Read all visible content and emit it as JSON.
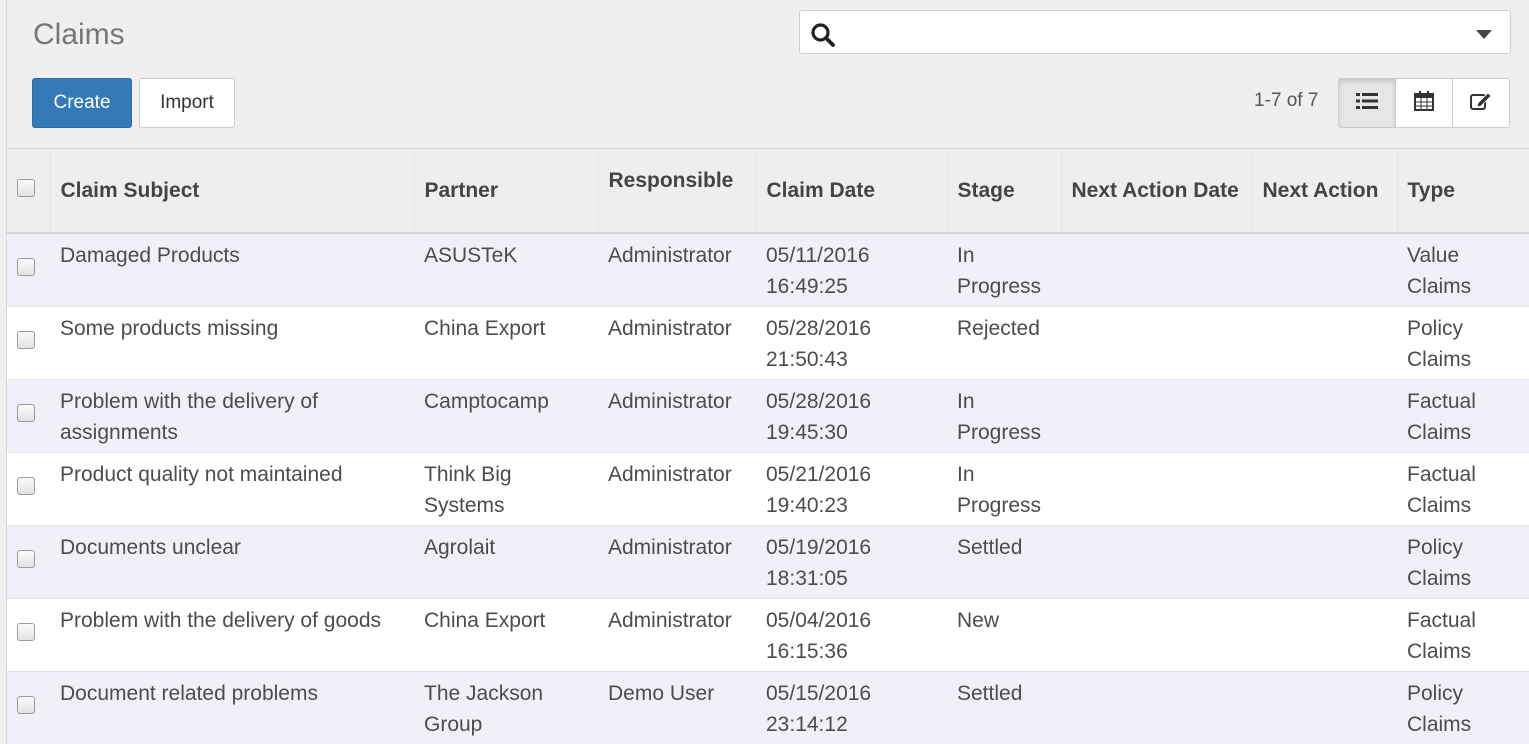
{
  "header": {
    "title": "Claims"
  },
  "search": {
    "value": "",
    "placeholder": ""
  },
  "buttons": {
    "create": "Create",
    "import": "Import"
  },
  "pager": {
    "text": "1-7 of 7"
  },
  "views": [
    {
      "name": "list-view",
      "icon": "list-icon",
      "active": true
    },
    {
      "name": "calendar-view",
      "icon": "calendar-icon",
      "active": false
    },
    {
      "name": "form-view",
      "icon": "edit-icon",
      "active": false
    }
  ],
  "table": {
    "columns": [
      "Claim Subject",
      "Partner",
      "Responsible",
      "Claim Date",
      "Stage",
      "Next Action Date",
      "Next Action",
      "Type"
    ],
    "rows": [
      [
        "Damaged Products",
        "ASUSTeK",
        "Administrator",
        "05/11/2016 16:49:25",
        "In Progress",
        "",
        "",
        "Value Claims"
      ],
      [
        "Some products missing",
        "China Export",
        "Administrator",
        "05/28/2016 21:50:43",
        "Rejected",
        "",
        "",
        "Policy Claims"
      ],
      [
        "Problem with the delivery of assignments",
        "Camptocamp",
        "Administrator",
        "05/28/2016 19:45:30",
        "In Progress",
        "",
        "",
        "Factual Claims"
      ],
      [
        "Product quality not maintained",
        "Think Big Systems",
        "Administrator",
        "05/21/2016 19:40:23",
        "In Progress",
        "",
        "",
        "Factual Claims"
      ],
      [
        "Documents unclear",
        "Agrolait",
        "Administrator",
        "05/19/2016 18:31:05",
        "Settled",
        "",
        "",
        "Policy Claims"
      ],
      [
        "Problem with the delivery of goods",
        "China Export",
        "Administrator",
        "05/04/2016 16:15:36",
        "New",
        "",
        "",
        "Factual Claims"
      ],
      [
        "Document related problems",
        "The Jackson Group",
        "Demo User",
        "05/15/2016 23:14:12",
        "Settled",
        "",
        "",
        "Policy Claims"
      ]
    ]
  },
  "colors": {
    "primary": "#337ab7",
    "control_panel_bg": "#f0eeee",
    "row_stripe": "#f0f0f9",
    "header_bg": "#eeeeee"
  }
}
